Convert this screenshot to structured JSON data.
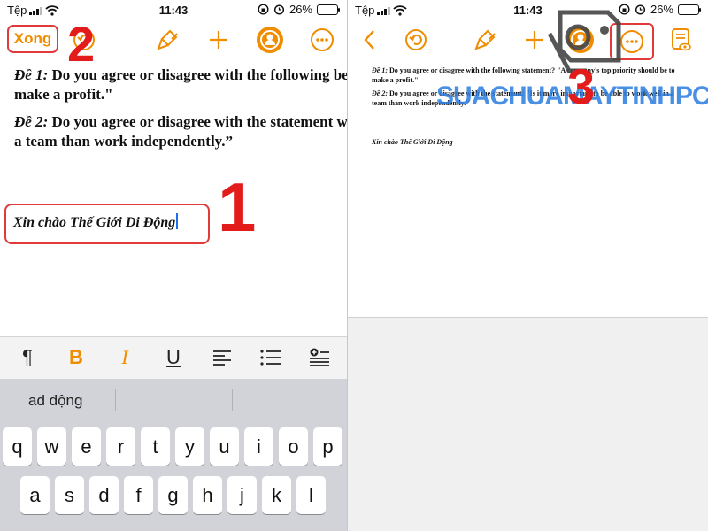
{
  "left": {
    "status": {
      "carrier": "Tệp",
      "time": "11:43",
      "battery": "26%"
    },
    "toolbar": {
      "done_label": "Xong"
    },
    "document": {
      "p1": {
        "label": "Đề 1:",
        "text": " Do you agree or disagree with the following be to make a profit.\""
      },
      "p2": {
        "label": "Đề 2:",
        "text": " Do you agree or disagree with the statement well in a team than work independently.”"
      },
      "greeting": "Xin chào Thế Giới Di Động"
    },
    "format": {
      "bold": "B",
      "italic": "I",
      "underline": "U"
    },
    "keyboard": {
      "suggestion": "ad động",
      "row1": [
        "q",
        "w",
        "e",
        "r",
        "t",
        "y",
        "u",
        "i",
        "o",
        "p"
      ],
      "row2": [
        "a",
        "s",
        "d",
        "f",
        "g",
        "h",
        "j",
        "k",
        "l"
      ]
    },
    "steps": {
      "one": "1",
      "two": "2"
    }
  },
  "right": {
    "status": {
      "carrier": "Tệp",
      "time": "11:43",
      "battery": "26%"
    },
    "document": {
      "p1": {
        "label": "Đề 1:",
        "text": " Do you agree or disagree with the following statement? \"A company's top priority should be to make a profit.\""
      },
      "p2": {
        "label": "Đề 2:",
        "text": " Do you agree or disagree with the statement: \"Is it more important to be able to work well in a team than work independently.\""
      },
      "greeting": "Xin chào Thế Giới Di Động"
    },
    "watermark": "SUACHUAMAYTINHPCI.COM",
    "steps": {
      "three": "3"
    }
  },
  "colors": {
    "accent": "#f08c00",
    "highlight": "#e03a3a",
    "cursor": "#1e6ff0"
  },
  "icons": [
    "back-icon",
    "undo-icon",
    "paintbrush-icon",
    "plus-icon",
    "collaborate-icon",
    "more-icon",
    "document-view-icon",
    "wifi-icon",
    "alarm-icon",
    "lock-rotation-icon"
  ]
}
